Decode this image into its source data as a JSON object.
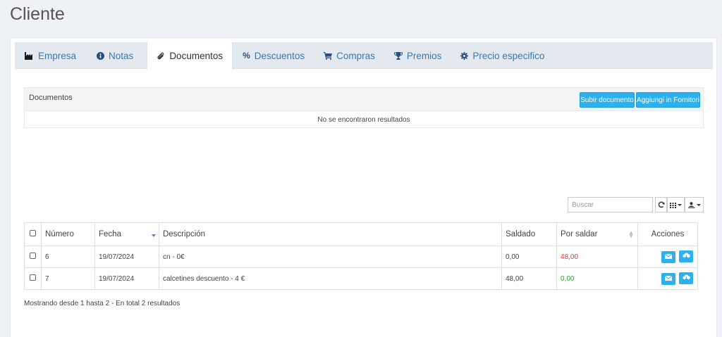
{
  "page": {
    "title": "Cliente"
  },
  "tabs": [
    {
      "label": "Empresa",
      "icon": "industry-icon",
      "active": false
    },
    {
      "label": "Notas",
      "icon": "info-circle-icon",
      "active": false
    },
    {
      "label": "Documentos",
      "icon": "paperclip-icon",
      "active": true
    },
    {
      "label": "Descuentos",
      "icon": "percent-icon",
      "active": false
    },
    {
      "label": "Compras",
      "icon": "shopping-cart-icon",
      "active": false
    },
    {
      "label": "Premios",
      "icon": "trophy-icon",
      "active": false
    },
    {
      "label": "Precio especifico",
      "icon": "cog-icon",
      "active": false
    }
  ],
  "documents": {
    "title": "Documentos",
    "upload_label": "Subir documento",
    "supplier_label": "Aggiungi in Fornitori",
    "empty_text": "No se encontraron resultados"
  },
  "toolbar": {
    "search_placeholder": "Buscar",
    "refresh_icon": "refresh-icon",
    "columns_icon": "columns-grid-icon",
    "export_icon": "export-user-icon"
  },
  "table": {
    "headers": {
      "numero": "Número",
      "fecha": "Fecha",
      "descripcion": "Descripción",
      "saldado": "Saldado",
      "por_saldar": "Por saldar",
      "acciones": "Acciones"
    },
    "rows": [
      {
        "numero": "6",
        "fecha": "19/07/2024",
        "descripcion": "cn - 0€",
        "saldado": "0,00",
        "por_saldar": "48,00",
        "por_saldar_color": "#e0353a"
      },
      {
        "numero": "7",
        "fecha": "19/07/2024",
        "descripcion": "calcetines descuento - 4 €",
        "saldado": "48,00",
        "por_saldar": "0,00",
        "por_saldar_color": "#2ba32b"
      }
    ]
  },
  "footer": {
    "summary": "Mostrando desde 1 hasta 2 - En total 2 resultados"
  },
  "colors": {
    "accent": "#2bb0f0",
    "link": "#337ab7",
    "negative": "#e0353a",
    "positive": "#2ba32b"
  }
}
